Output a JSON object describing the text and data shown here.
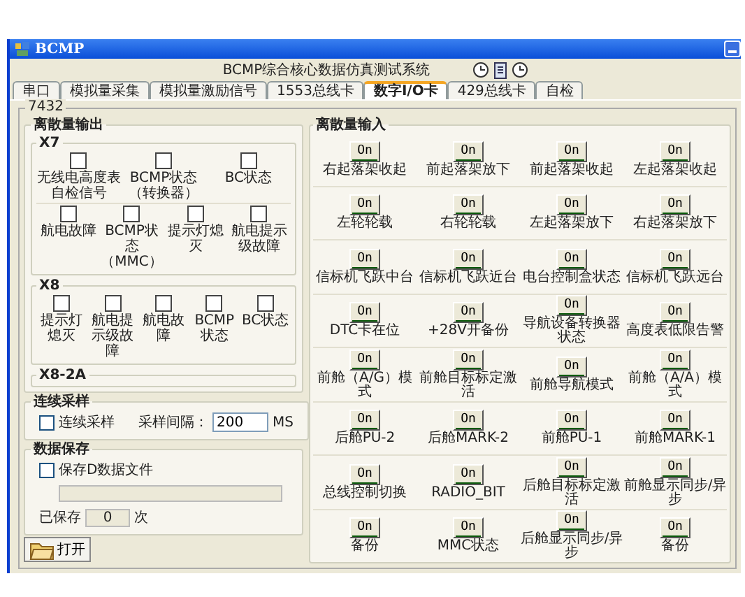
{
  "window": {
    "title": "BCMP"
  },
  "system_title": "BCMP综合核心数据仿真测试系统",
  "tabs": [
    {
      "label": "串口",
      "selected": false
    },
    {
      "label": "模拟量采集",
      "selected": false
    },
    {
      "label": "模拟量激励信号",
      "selected": false
    },
    {
      "label": "1553总线卡",
      "selected": false
    },
    {
      "label": "数字I/O卡",
      "selected": true
    },
    {
      "label": "429总线卡",
      "selected": false
    },
    {
      "label": "自检",
      "selected": false
    }
  ],
  "card_group": "7432",
  "discrete_output": {
    "title": "离散量输出",
    "groups": [
      {
        "title": "X7",
        "rows": [
          {
            "checkboxes": [
              {
                "label": "无线电高度表自检信号",
                "checked": false
              },
              {
                "label": "BCMP状态（转换器）",
                "checked": false
              },
              {
                "label": "BC状态",
                "checked": false
              }
            ]
          },
          {
            "checkboxes": [
              {
                "label": "航电故障",
                "checked": false
              },
              {
                "label": "BCMP状态（MMC）",
                "checked": false
              },
              {
                "label": "提示灯熄灭",
                "checked": false
              },
              {
                "label": "航电提示级故障",
                "checked": false
              }
            ]
          }
        ]
      },
      {
        "title": "X8",
        "rows": [
          {
            "checkboxes": [
              {
                "label": "提示灯熄灭",
                "checked": false
              },
              {
                "label": "航电提示级故障",
                "checked": false
              },
              {
                "label": "航电故障",
                "checked": false
              },
              {
                "label": "BCMP状态",
                "checked": false
              },
              {
                "label": "BC状态",
                "checked": false
              }
            ]
          }
        ]
      },
      {
        "title": "X8-2A"
      }
    ]
  },
  "continuous_sampling": {
    "title": "连续采样",
    "checkbox": {
      "label": "连续采样",
      "checked": false
    },
    "interval_label": "采样间隔：",
    "interval_value": "200",
    "unit": "MS"
  },
  "data_save": {
    "title": "数据保存",
    "checkbox": {
      "label": "保存D数据文件",
      "checked": false
    },
    "saved_label": "已保存",
    "saved_count": "0",
    "saved_unit": "次"
  },
  "open_button": "打开",
  "discrete_input": {
    "title": "离散量输入",
    "items": [
      {
        "label": "右起落架收起",
        "button": "On",
        "on": true
      },
      {
        "label": "前起落架放下",
        "button": "On",
        "on": true
      },
      {
        "label": "前起落架收起",
        "button": "On",
        "on": true
      },
      {
        "label": "左起落架收起",
        "button": "On",
        "on": true
      },
      {
        "label": "左轮轮载",
        "button": "On",
        "on": true
      },
      {
        "label": "右轮轮载",
        "button": "On",
        "on": true
      },
      {
        "label": "左起落架放下",
        "button": "On",
        "on": true
      },
      {
        "label": "右起落架放下",
        "button": "On",
        "on": true
      },
      {
        "label": "信标机飞跃中台",
        "button": "On",
        "on": true
      },
      {
        "label": "信标机飞跃近台",
        "button": "On",
        "on": true
      },
      {
        "label": "电台控制盒状态",
        "button": "On",
        "on": true
      },
      {
        "label": "信标机飞跃远台",
        "button": "On",
        "on": true
      },
      {
        "label": "DTC卡在位",
        "button": "On",
        "on": true
      },
      {
        "label": "+28V开备份",
        "button": "On",
        "on": true
      },
      {
        "label": "导航设备转换器状态",
        "button": "On",
        "on": true
      },
      {
        "label": "高度表低限告警",
        "button": "On",
        "on": true
      },
      {
        "label": "前舱（A/G）模式",
        "button": "On",
        "on": true
      },
      {
        "label": "前舱目标标定激活",
        "button": "On",
        "on": true
      },
      {
        "label": "前舱导航模式",
        "button": "On",
        "on": true
      },
      {
        "label": "前舱（A/A）模式",
        "button": "On",
        "on": true
      },
      {
        "label": "后舱PU-2",
        "button": "On",
        "on": true
      },
      {
        "label": "后舱MARK-2",
        "button": "On",
        "on": true
      },
      {
        "label": "前舱PU-1",
        "button": "On",
        "on": true
      },
      {
        "label": "前舱MARK-1",
        "button": "On",
        "on": true
      },
      {
        "label": "总线控制切换",
        "button": "On",
        "on": true
      },
      {
        "label": "RADIO_BIT",
        "button": "On",
        "on": true
      },
      {
        "label": "后舱目标标定激活",
        "button": "On",
        "on": true
      },
      {
        "label": "前舱显示同步/异步",
        "button": "On",
        "on": true
      },
      {
        "label": "备份",
        "button": "On",
        "on": true
      },
      {
        "label": "MMC状态",
        "button": "On",
        "on": true
      },
      {
        "label": "后舱显示同步/异步",
        "button": "On",
        "on": true
      },
      {
        "label": "备份",
        "button": "On",
        "on": true
      }
    ]
  }
}
